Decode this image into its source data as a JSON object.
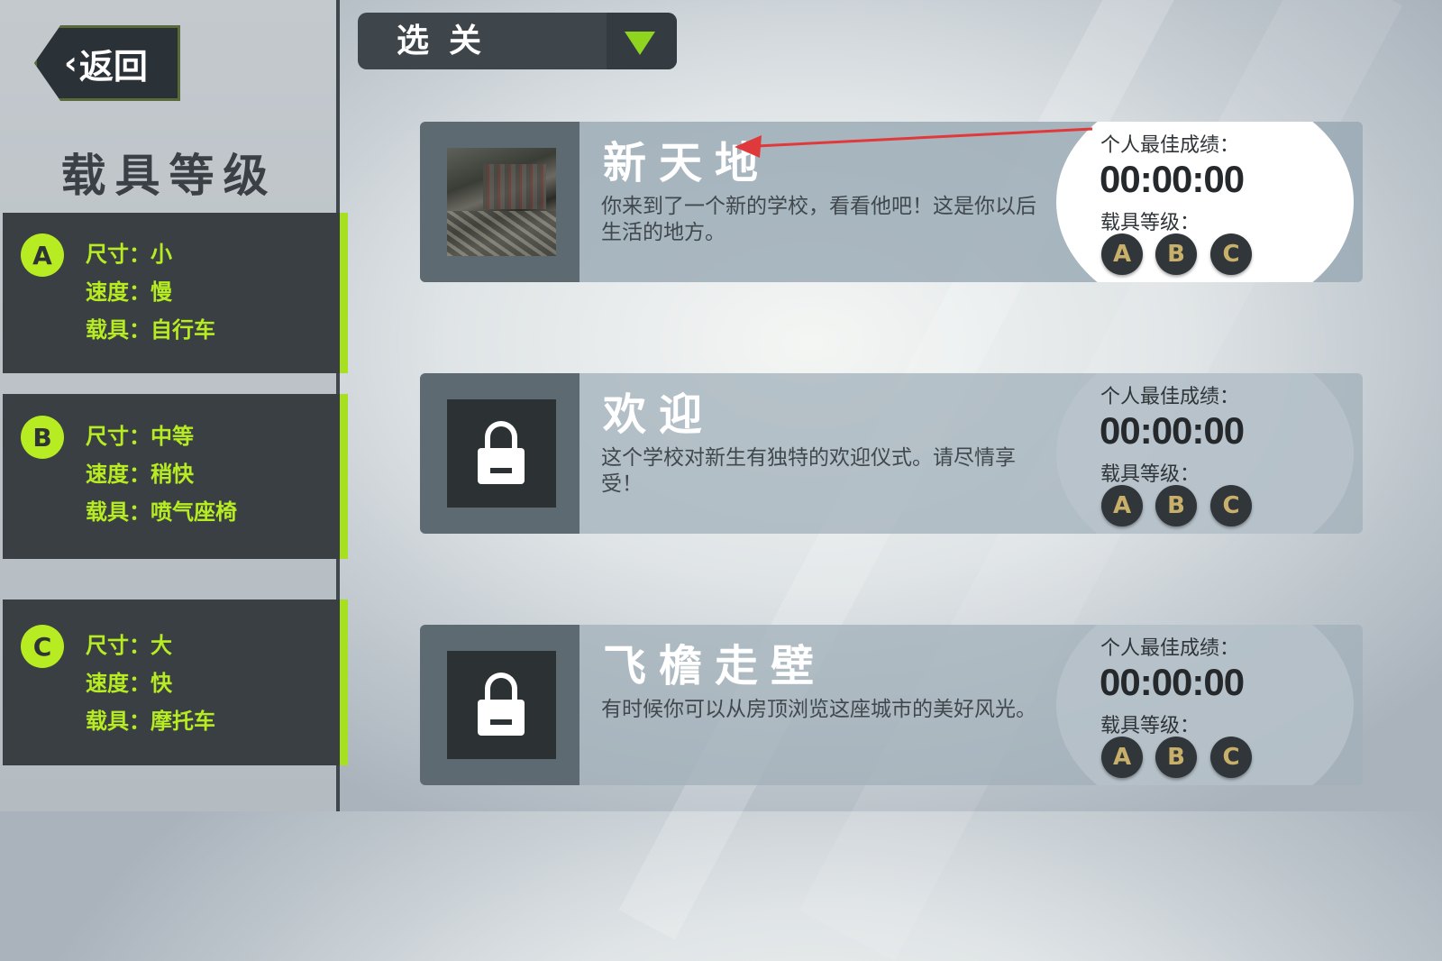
{
  "back_button": {
    "label": "返回"
  },
  "vehicle_panel": {
    "title": "载具等级",
    "grades": [
      {
        "badge": "A",
        "size": "尺寸：小",
        "speed": "速度：慢",
        "vehicle": "载具：自行车"
      },
      {
        "badge": "B",
        "size": "尺寸：中等",
        "speed": "速度：稍快",
        "vehicle": "载具：喷气座椅"
      },
      {
        "badge": "C",
        "size": "尺寸：大",
        "speed": "速度：快",
        "vehicle": "载具：摩托车"
      }
    ]
  },
  "level_select": {
    "label": "选关"
  },
  "levels": [
    {
      "name": "新天地",
      "description": "你来到了一个新的学校，看看他吧！这是你以后生活的地方。",
      "locked": false,
      "best_label": "个人最佳成绩：",
      "best_time": "00:00:00",
      "grade_label": "载具等级：",
      "grades": [
        "A",
        "B",
        "C"
      ]
    },
    {
      "name": "欢迎",
      "description": "这个学校对新生有独特的欢迎仪式。请尽情享受！",
      "locked": true,
      "best_label": "个人最佳成绩：",
      "best_time": "00:00:00",
      "grade_label": "载具等级：",
      "grades": [
        "A",
        "B",
        "C"
      ]
    },
    {
      "name": "飞檐走壁",
      "description": "有时候你可以从房顶浏览这座城市的美好风光。",
      "locked": true,
      "best_label": "个人最佳成绩：",
      "best_time": "00:00:00",
      "grade_label": "载具等级：",
      "grades": [
        "A",
        "B",
        "C"
      ]
    }
  ],
  "colors": {
    "accent": "#b7ec22",
    "annotation_arrow": "#e0393b"
  },
  "icons": {
    "back": "chevron-left-icon",
    "dropdown": "triangle-down-icon",
    "lock": "lock-icon"
  }
}
